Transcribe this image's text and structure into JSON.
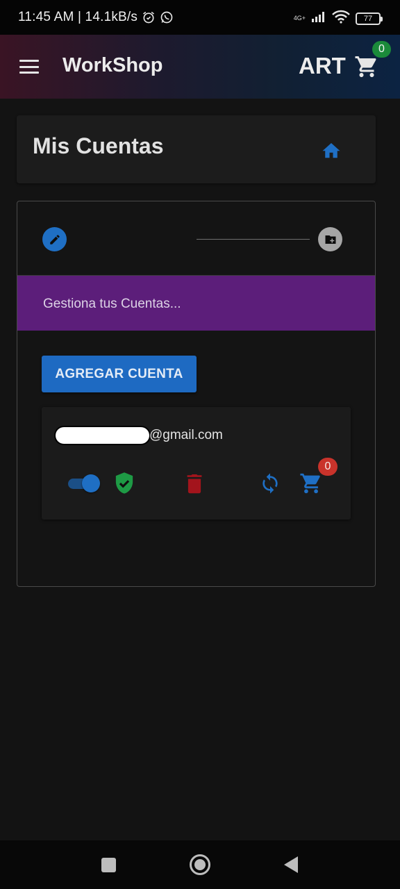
{
  "status_bar": {
    "time": "11:45 AM | 14.1kB/s",
    "network": "4G+",
    "battery": "77",
    "icons": [
      "alarm-icon",
      "whatsapp-icon",
      "signal-icon",
      "wifi-icon",
      "battery-icon"
    ]
  },
  "app_bar": {
    "title": "WorkShop",
    "store_label": "ART",
    "cart_count": "0",
    "icons": [
      "menu-icon",
      "cart-icon"
    ]
  },
  "header": {
    "title": "Mis Cuentas",
    "icon": "home-icon"
  },
  "stepper": {
    "steps": [
      {
        "icon": "edit-icon",
        "active": true
      },
      {
        "icon": "create-folder-icon",
        "active": false
      }
    ],
    "banner_text": "Gestiona tus Cuentas...",
    "add_button_label": "AGREGAR CUENTA"
  },
  "account": {
    "email_domain": "@gmail.com",
    "enabled": true,
    "cart_count": "0",
    "icons": [
      "toggle-switch",
      "verified-shield-icon",
      "delete-icon",
      "refresh-icon",
      "cart-icon"
    ]
  },
  "colors": {
    "background": "#131313",
    "card": "#1c1c1c",
    "accent_blue": "#1f6fc4",
    "banner_purple": "#5c1e7a",
    "success_green": "#1b8a3a",
    "danger_red": "#c9332b",
    "delete_red": "#a3141c"
  },
  "nav_bar": {
    "icons": [
      "recents-square-icon",
      "home-circle-icon",
      "back-triangle-icon"
    ]
  }
}
